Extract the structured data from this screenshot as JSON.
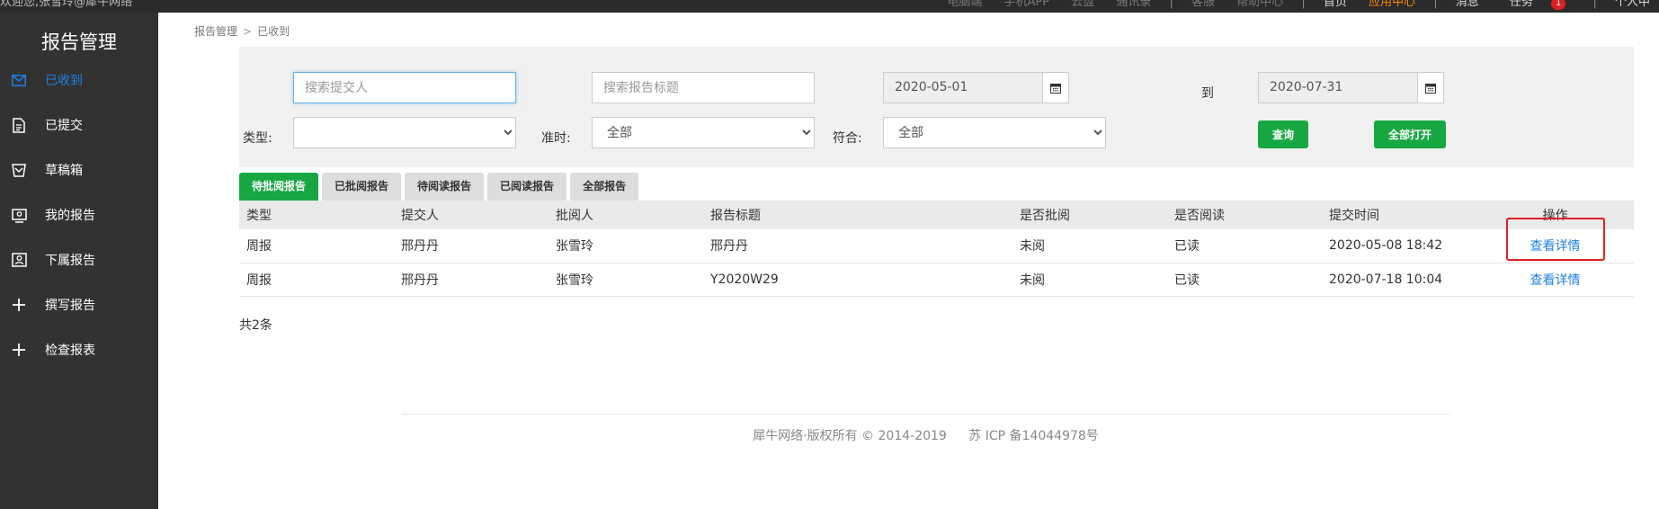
{
  "topbar": {
    "welcome": "欢迎您,张雪玲@犀牛网络",
    "links": [
      "电脑端",
      "手机APP",
      "云盘",
      "通讯录"
    ],
    "links2": [
      "客服",
      "帮助中心"
    ],
    "home": "首页",
    "app_center": "应用中心",
    "messages": "消息",
    "tasks": "任务",
    "task_badge": "1",
    "profile": "个人中"
  },
  "sidebar": {
    "title": "报告管理",
    "items": [
      {
        "label": "已收到",
        "icon": "envelope-icon"
      },
      {
        "label": "已提交",
        "icon": "document-icon"
      },
      {
        "label": "草稿箱",
        "icon": "draft-box-icon"
      },
      {
        "label": "我的报告",
        "icon": "my-report-icon"
      },
      {
        "label": "下属报告",
        "icon": "subordinate-report-icon"
      },
      {
        "label": "撰写报告",
        "icon": "plus-icon"
      },
      {
        "label": "检查报表",
        "icon": "plus-icon"
      }
    ]
  },
  "breadcrumb": {
    "root": "报告管理",
    "sep": ">",
    "current": "已收到"
  },
  "filter": {
    "submitter_placeholder": "搜索提交人",
    "title_placeholder": "搜索报告标题",
    "date_from": "2020-05-01",
    "date_to_label": "到",
    "date_to": "2020-07-31",
    "type_label": "类型:",
    "type_value": "",
    "ontime_label": "准时:",
    "ontime_value": "全部",
    "match_label": "符合:",
    "match_value": "全部",
    "query_button": "查询",
    "open_all_button": "全部打开"
  },
  "tabs": [
    "待批阅报告",
    "已批阅报告",
    "待阅读报告",
    "已阅读报告",
    "全部报告"
  ],
  "table": {
    "headers": [
      "类型",
      "提交人",
      "批阅人",
      "报告标题",
      "是否批阅",
      "是否阅读",
      "提交时间",
      "操作"
    ],
    "rows": [
      [
        "周报",
        "邢丹丹",
        "张雪玲",
        "邢丹丹",
        "未阅",
        "已读",
        "2020-05-08 18:42",
        "查看详情"
      ],
      [
        "周报",
        "邢丹丹",
        "张雪玲",
        "Y2020W29",
        "未阅",
        "已读",
        "2020-07-18 10:04",
        "查看详情"
      ]
    ]
  },
  "total": "共2条",
  "footer": {
    "copyright": "犀牛网络·版权所有 © 2014-2019",
    "icp": "苏 ICP 备14044978号"
  }
}
